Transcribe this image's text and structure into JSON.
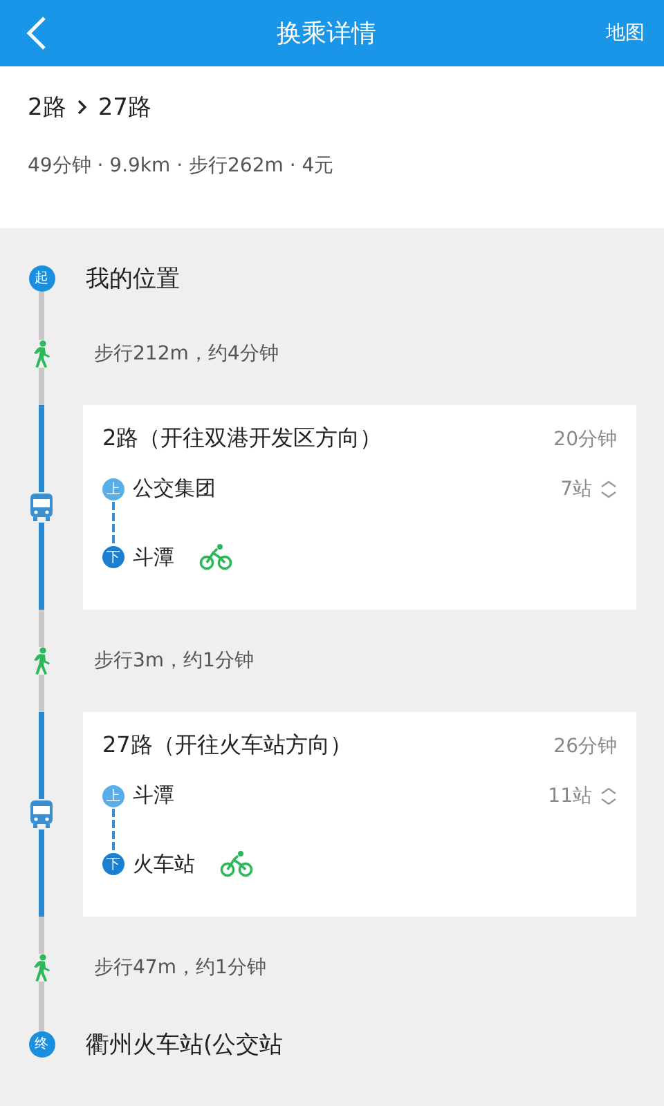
{
  "header": {
    "title": "换乘详情",
    "action": "地图"
  },
  "summary": {
    "routes": [
      "2路",
      "27路"
    ],
    "info": "49分钟 · 9.9km · 步行262m · 4元"
  },
  "steps": [
    {
      "kind": "start",
      "badge": "起",
      "text": "我的位置"
    },
    {
      "kind": "walk",
      "text": "步行212m，约4分钟"
    },
    {
      "kind": "bus",
      "line": "2路（开往双港开发区方向）",
      "duration": "20分钟",
      "board": {
        "badge": "上",
        "name": "公交集团"
      },
      "stops": "7站",
      "alight": {
        "badge": "下",
        "name": "斗潭"
      }
    },
    {
      "kind": "walk",
      "text": "步行3m，约1分钟"
    },
    {
      "kind": "bus",
      "line": "27路（开往火车站方向）",
      "duration": "26分钟",
      "board": {
        "badge": "上",
        "name": "斗潭"
      },
      "stops": "11站",
      "alight": {
        "badge": "下",
        "name": "火车站"
      }
    },
    {
      "kind": "walk",
      "text": "步行47m，约1分钟"
    },
    {
      "kind": "end",
      "badge": "终",
      "text": "衢州火车站(公交站"
    }
  ]
}
